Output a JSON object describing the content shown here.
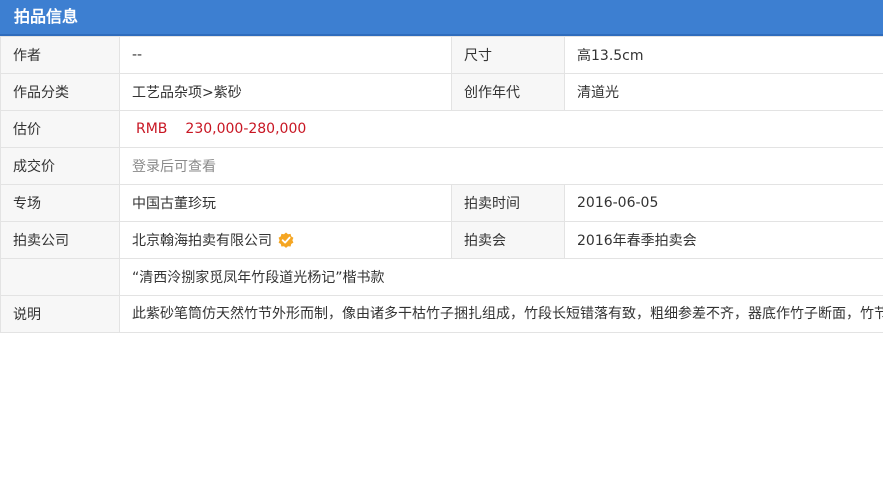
{
  "header": {
    "title": "拍品信息"
  },
  "rows": {
    "author_label": "作者",
    "author_value": "--",
    "size_label": "尺寸",
    "size_value": "高13.5cm",
    "category_label": "作品分类",
    "category_value": "工艺品杂项>紫砂",
    "era_label": "创作年代",
    "era_value": "清道光",
    "estimate_label": "估价",
    "estimate_currency": "RMB",
    "estimate_range": "230,000-280,000",
    "deal_label": "成交价",
    "deal_value": "登录后可查看",
    "session_label": "专场",
    "session_value": "中国古董珍玩",
    "auction_time_label": "拍卖时间",
    "auction_time_value": "2016-06-05",
    "company_label": "拍卖公司",
    "company_value": "北京翰海拍卖有限公司",
    "sale_label": "拍卖会",
    "sale_value": "2016年春季拍卖会"
  },
  "description": {
    "title": "“清西泠捌家觅凤年竹段道光杨记”楷书款",
    "label": "说明",
    "body": "此紫砂笔筒仿天然竹节外形而制，像由诸多干枯竹子捆扎组成，竹段长短错落有致，粗细参差不齐，器底作竹子断面，竹节及纹理表现逼真，体现出作者高超的造型功力。底部有“清西泠捌家觅凤年竹段道光杨记”楷书款，杨凤年为清代嘉庆年间制壶名家，荆溪人，一说浙江桐乡人，杨彭年之妹。其作品构思巧妙，浮雕精美，可与其兄媲美。西泠八家是指由丁敬、蒋仁、黄易、奚冈、赵之琛等人组成的篆刻家流派。都是浙江杭州人，故又称浙派，篆刻风格皆师秦汉，讲究刀法，苍劲质朴。"
  },
  "icons": {
    "verified": "verified-badge-icon"
  },
  "colors": {
    "header_bg": "#3d7fd1",
    "price": "#c81623",
    "label_bg": "#f7f7f7",
    "border": "#e3e3e3"
  }
}
